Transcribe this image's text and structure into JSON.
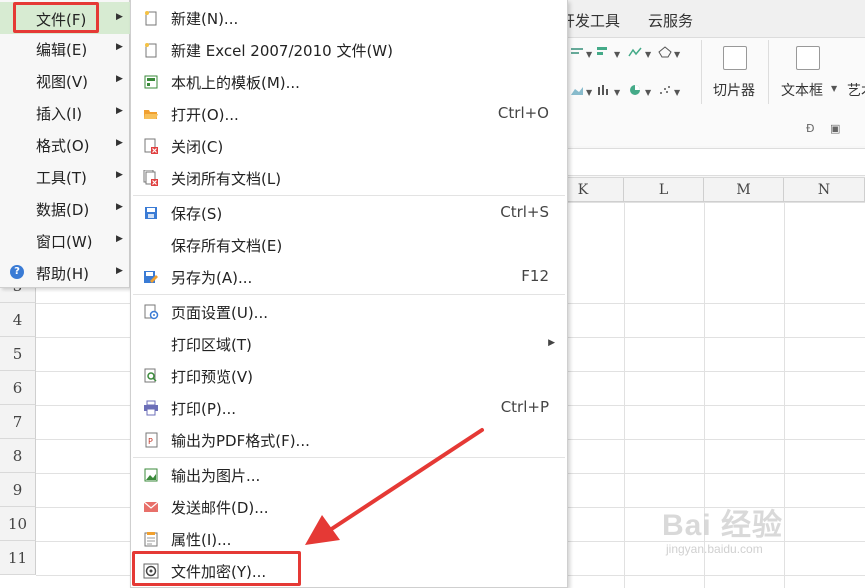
{
  "ribbon": {
    "tab_developer": "开发工具",
    "tab_cloud": "云服务",
    "slicer_label": "切片器",
    "textbox_label": "文本框",
    "art_label": "艺术"
  },
  "columns": [
    "K",
    "L",
    "M",
    "N"
  ],
  "rows": [
    "3",
    "4",
    "5",
    "6",
    "7",
    "8",
    "9",
    "10",
    "11"
  ],
  "main_menu": {
    "items": [
      {
        "label": "文件(F)"
      },
      {
        "label": "编辑(E)"
      },
      {
        "label": "视图(V)"
      },
      {
        "label": "插入(I)"
      },
      {
        "label": "格式(O)"
      },
      {
        "label": "工具(T)"
      },
      {
        "label": "数据(D)"
      },
      {
        "label": "窗口(W)"
      },
      {
        "label": "帮助(H)"
      }
    ]
  },
  "file_menu": {
    "items": [
      {
        "label": "新建(N)...",
        "shortcut": "",
        "icon": "new-doc-icon"
      },
      {
        "label": "新建 Excel 2007/2010 文件(W)",
        "shortcut": "",
        "icon": "new-excel-icon"
      },
      {
        "label": "本机上的模板(M)...",
        "shortcut": "",
        "icon": "template-icon"
      },
      {
        "label": "打开(O)...",
        "shortcut": "Ctrl+O",
        "icon": "open-folder-icon"
      },
      {
        "label": "关闭(C)",
        "shortcut": "",
        "icon": "close-doc-icon"
      },
      {
        "label": "关闭所有文档(L)",
        "shortcut": "",
        "icon": "close-all-icon"
      },
      {
        "label": "保存(S)",
        "shortcut": "Ctrl+S",
        "icon": "save-icon"
      },
      {
        "label": "保存所有文档(E)",
        "shortcut": "",
        "icon": ""
      },
      {
        "label": "另存为(A)...",
        "shortcut": "F12",
        "icon": "save-as-icon"
      },
      {
        "label": "页面设置(U)...",
        "shortcut": "",
        "icon": "page-setup-icon"
      },
      {
        "label": "打印区域(T)",
        "shortcut": "",
        "icon": ""
      },
      {
        "label": "打印预览(V)",
        "shortcut": "",
        "icon": "print-preview-icon"
      },
      {
        "label": "打印(P)...",
        "shortcut": "Ctrl+P",
        "icon": "printer-icon"
      },
      {
        "label": "输出为PDF格式(F)...",
        "shortcut": "",
        "icon": "pdf-icon"
      },
      {
        "label": "输出为图片...",
        "shortcut": "",
        "icon": "image-export-icon"
      },
      {
        "label": "发送邮件(D)...",
        "shortcut": "",
        "icon": "mail-icon"
      },
      {
        "label": "属性(I)...",
        "shortcut": "",
        "icon": "properties-icon"
      },
      {
        "label": "文件加密(Y)...",
        "shortcut": "",
        "icon": "encrypt-icon"
      }
    ]
  },
  "watermark": {
    "brand": "Bai 经验",
    "url": "jingyan.baidu.com"
  },
  "colors": {
    "highlight_red": "#e53935",
    "menu_active": "#d7ebd2"
  }
}
